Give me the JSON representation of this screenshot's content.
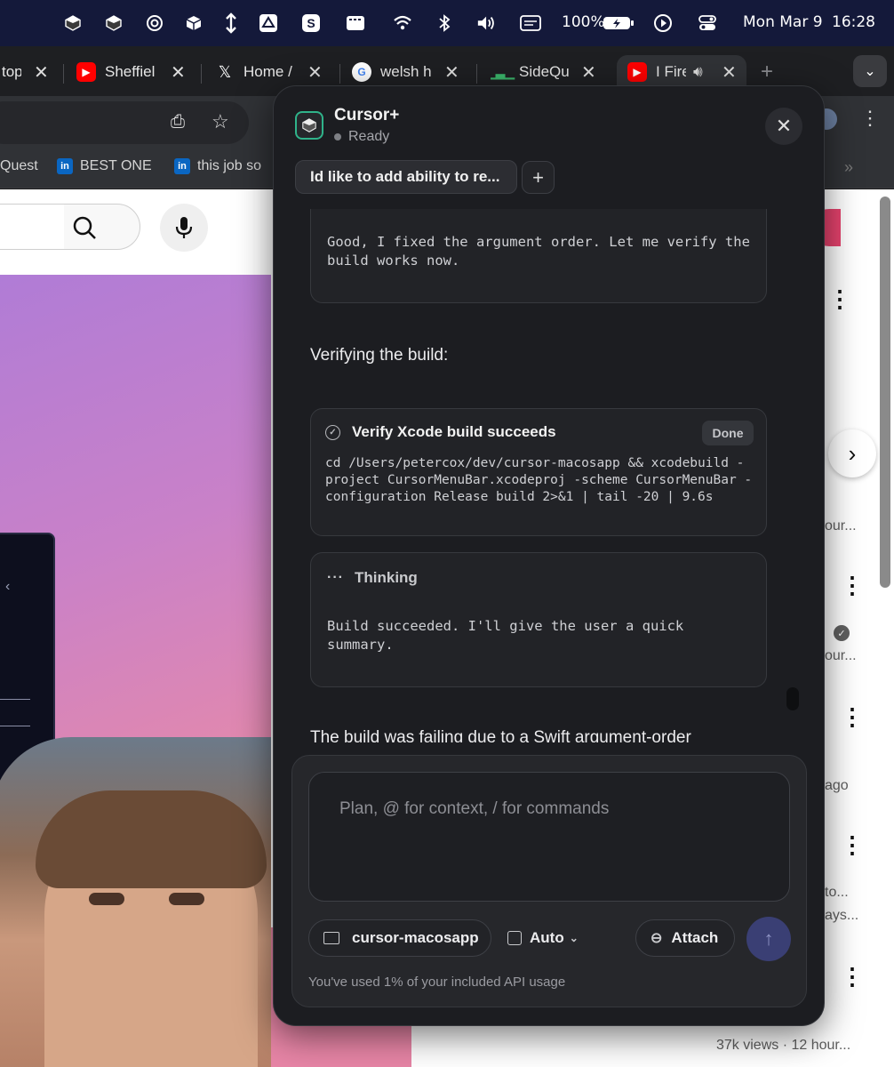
{
  "menubar": {
    "battery": "100%",
    "date": "Mon Mar 9",
    "time": "16:28",
    "icons": [
      "cursor-app-icon",
      "cursor-app-icon-2",
      "chatgpt-icon",
      "box-icon",
      "resize-vertical-icon",
      "drive-icon",
      "s-app-icon",
      "keyboard-icon",
      "wifi-icon",
      "bluetooth-icon",
      "volume-icon",
      "display-icon",
      "battery-icon",
      "play-icon",
      "control-center-icon"
    ]
  },
  "tabs": [
    {
      "title": "top",
      "favicon": "page-icon"
    },
    {
      "title": "Sheffiel",
      "favicon": "youtube-icon"
    },
    {
      "title": "Home /",
      "favicon": "x-icon"
    },
    {
      "title": "welsh h",
      "favicon": "google-icon"
    },
    {
      "title": "SideQu",
      "favicon": "chart-icon"
    },
    {
      "title": "I Fire",
      "favicon": "youtube-icon",
      "active": true
    }
  ],
  "bookmarks": [
    {
      "label": "Quest"
    },
    {
      "label": "BEST ONE",
      "icon": "in"
    },
    {
      "label": "this job so",
      "icon": "in"
    }
  ],
  "youtube": {
    "right_rail": {
      "texts": [
        "our...",
        "our...",
        "ago",
        "to...",
        "ays...",
        "37k views · 12 hour..."
      ]
    }
  },
  "panel": {
    "title": "Cursor+",
    "status": "Ready",
    "chat_tab": "Id like to add ability to re...",
    "new_tab": "+",
    "messages": {
      "thinking_1": "Good, I fixed the argument order. Let me verify the build works now.",
      "verifying": "Verifying the build:",
      "tool_title": "Verify Xcode build succeeds",
      "tool_status": "Done",
      "tool_command": "cd /Users/petercox/dev/cursor-macosapp && xcodebuild -project CursorMenuBar.xcodeproj -scheme CursorMenuBar -configuration Release build 2>&1 | tail -20 | 9.6s",
      "thinking_label": "Thinking",
      "thinking_2": "Build succeeded. I'll give the user a quick summary.",
      "summary_cutoff": "The build was failing due to a Swift argument-order"
    },
    "composer": {
      "placeholder": "Plan, @ for context, / for commands",
      "folder": "cursor-macosapp",
      "model": "Auto",
      "attach": "Attach",
      "usage": "You've used 1% of your included API usage"
    },
    "accent": "#2fb38a"
  }
}
